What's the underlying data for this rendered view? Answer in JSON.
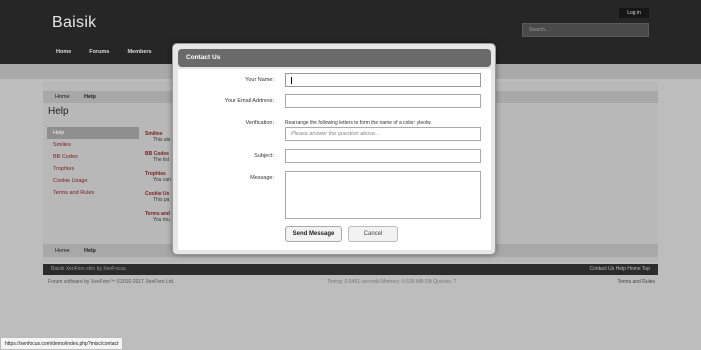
{
  "site": {
    "logo": "Baisik",
    "login": "Log in",
    "search_placeholder": "Search...",
    "nav": [
      "Home",
      "Forums",
      "Members"
    ]
  },
  "breadcrumb": [
    "Home",
    "Help"
  ],
  "page_title": "Help",
  "sidebar": [
    "Help",
    "Smilies",
    "BB Codes",
    "Trophies",
    "Cookie Usage",
    "Terms and Rules"
  ],
  "mainlist": [
    {
      "title": "Smilies",
      "desc": "This als"
    },
    {
      "title": "BB Codes",
      "desc": "The list"
    },
    {
      "title": "Trophies",
      "desc": "You can"
    },
    {
      "title": "Cookie Us",
      "desc": "This pa"
    },
    {
      "title": "Terms and",
      "desc": "You mu"
    }
  ],
  "footer": {
    "left": "Baisik    XenForo skin by XenFocus",
    "right": "Contact Us   Help   Home   Top",
    "copyright": "Forum software by XenForo™ ©2010-2017 XenForo Ltd.",
    "timing": "Timing: 0.0491 seconds Memory: 6.639 MB DB Queries: 7",
    "terms": "Terms and Rules"
  },
  "modal": {
    "title": "Contact Us",
    "name_label": "Your Name:",
    "email_label": "Your Email Address:",
    "verification_label": "Verification:",
    "question": "Rearrange the following letters to form the name of a color: yleolw",
    "answer_placeholder": "Please answer the question above...",
    "subject_label": "Subject:",
    "message_label": "Message:",
    "send_label": "Send Message",
    "cancel_label": "Cancel"
  },
  "status_url": "https://xenfocus.com/demo/index.php?misc/contact"
}
